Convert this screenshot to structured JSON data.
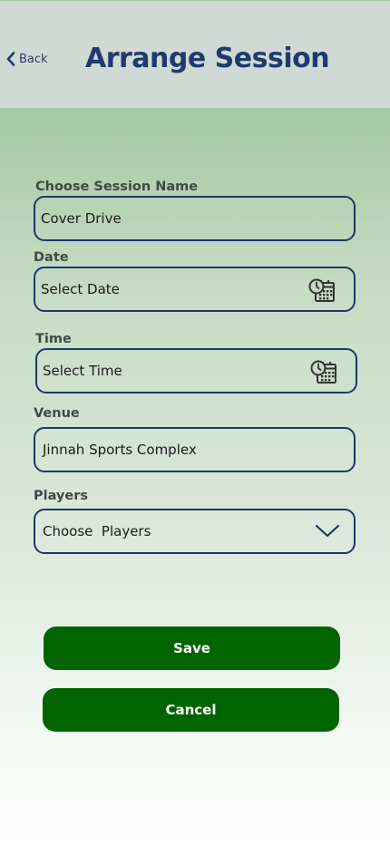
{
  "header": {
    "back_label": "Back",
    "title": "Arrange Session"
  },
  "form": {
    "session_name": {
      "label": "Choose Session Name",
      "value": "Cover Drive"
    },
    "date": {
      "label": "Date",
      "placeholder": "Select Date",
      "icon": "calendar-clock-icon"
    },
    "time": {
      "label": "Time",
      "placeholder": "Select Time",
      "icon": "calendar-clock-icon"
    },
    "venue": {
      "label": "Venue",
      "value": "Jinnah Sports Complex"
    },
    "players": {
      "label": "Players",
      "placeholder": "Choose  Players",
      "icon": "chevron-down-icon"
    }
  },
  "actions": {
    "save_label": "Save",
    "cancel_label": "Cancel"
  },
  "colors": {
    "header_bg": "#d0dad4",
    "title": "#1e3a6e",
    "field_border": "#1d3866",
    "button_bg": "#006400",
    "button_text": "#ffffff"
  }
}
